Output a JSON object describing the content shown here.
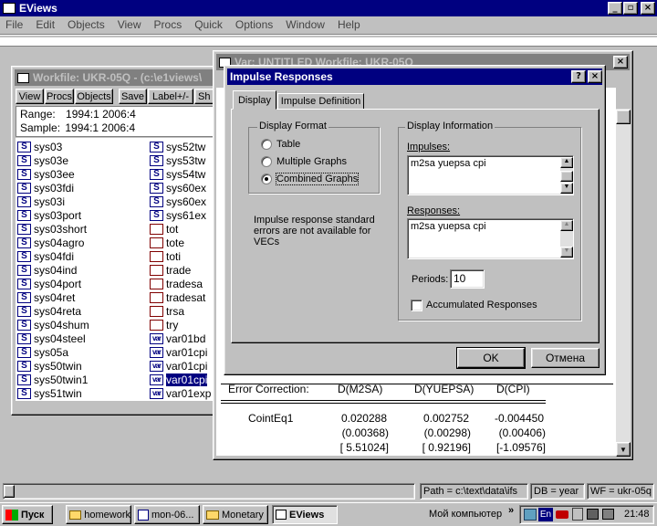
{
  "app": {
    "title": "EViews",
    "menu": [
      "File",
      "Edit",
      "Objects",
      "View",
      "Procs",
      "Quick",
      "Options",
      "Window",
      "Help"
    ]
  },
  "workfile": {
    "title": "Workfile: UKR-05Q - (c:\\e1views\\",
    "toolbar": [
      "View",
      "Procs",
      "Objects",
      "Save",
      "Label+/-",
      "Sh"
    ],
    "range_label": "Range:",
    "range_value": "1994:1 2006:4",
    "sample_label": "Sample:",
    "sample_value": "1994:1 2006:4",
    "col1": [
      {
        "t": "S",
        "n": "sys03"
      },
      {
        "t": "S",
        "n": "sys03e"
      },
      {
        "t": "S",
        "n": "sys03ee"
      },
      {
        "t": "S",
        "n": "sys03fdi"
      },
      {
        "t": "S",
        "n": "sys03i"
      },
      {
        "t": "S",
        "n": "sys03port"
      },
      {
        "t": "S",
        "n": "sys03short"
      },
      {
        "t": "S",
        "n": "sys04agro"
      },
      {
        "t": "S",
        "n": "sys04fdi"
      },
      {
        "t": "S",
        "n": "sys04ind"
      },
      {
        "t": "S",
        "n": "sys04port"
      },
      {
        "t": "S",
        "n": "sys04ret"
      },
      {
        "t": "S",
        "n": "sys04reta"
      },
      {
        "t": "S",
        "n": "sys04shum"
      },
      {
        "t": "S",
        "n": "sys04steel"
      },
      {
        "t": "S",
        "n": "sys05a"
      },
      {
        "t": "S",
        "n": "sys50twin"
      },
      {
        "t": "S",
        "n": "sys50twin1"
      },
      {
        "t": "S",
        "n": "sys51twin"
      }
    ],
    "col2": [
      {
        "t": "S",
        "n": "sys52tw"
      },
      {
        "t": "S",
        "n": "sys53tw"
      },
      {
        "t": "S",
        "n": "sys54tw"
      },
      {
        "t": "S",
        "n": "sys60ex"
      },
      {
        "t": "S",
        "n": "sys60ex"
      },
      {
        "t": "S",
        "n": "sys61ex"
      },
      {
        "t": "G",
        "n": "tot"
      },
      {
        "t": "G",
        "n": "tote"
      },
      {
        "t": "G",
        "n": "toti"
      },
      {
        "t": "G",
        "n": "trade"
      },
      {
        "t": "G",
        "n": "tradesa"
      },
      {
        "t": "G",
        "n": "tradesat"
      },
      {
        "t": "G",
        "n": "trsa"
      },
      {
        "t": "G",
        "n": "try"
      },
      {
        "t": "V",
        "n": "var01bd"
      },
      {
        "t": "V",
        "n": "var01cpi"
      },
      {
        "t": "V",
        "n": "var01cpi"
      },
      {
        "t": "V",
        "n": "var01cpi"
      },
      {
        "t": "V",
        "n": "var01exp"
      }
    ],
    "badge_labels": {
      "S": "S",
      "V": "var",
      "G": ""
    }
  },
  "var_window": {
    "title": "Var: UNTITLED   Workfile: UKR-05Q",
    "table": {
      "label": "Error Correction:",
      "headers": [
        "D(M2SA)",
        "D(YUEPSA)",
        "D(CPI)"
      ],
      "row_label": "CointEq1",
      "values": [
        "0.020288",
        "0.002752",
        "-0.004450"
      ],
      "se": [
        "(0.00368)",
        "(0.00298)",
        "(0.00406)"
      ],
      "t": [
        "[ 5.51024]",
        "[ 0.92196]",
        "[-1.09576]"
      ]
    }
  },
  "dialog": {
    "title": "Impulse Responses",
    "help": "?",
    "close": "×",
    "tabs": [
      "Display",
      "Impulse Definition"
    ],
    "display_format_label": "Display Format",
    "options": [
      "Table",
      "Multiple Graphs",
      "Combined Graphs"
    ],
    "selected": "Combined Graphs",
    "note": "Impulse response standard errors are not available for VECs",
    "display_info_label": "Display Information",
    "impulses_label": "Impulses:",
    "impulses_value": "m2sa yuepsa cpi",
    "responses_label": "Responses:",
    "responses_value": "m2sa yuepsa cpi",
    "periods_label": "Periods:",
    "periods_value": "10",
    "accumulated_label": "Accumulated Responses",
    "accumulated_checked": false,
    "ok": "OK",
    "cancel": "Отмена"
  },
  "status": {
    "path": "Path = c:\\text\\data\\ifs",
    "db": "DB = year",
    "wf": "WF = ukr-05q"
  },
  "taskbar": {
    "start": "Пуск",
    "buttons": [
      "homework",
      "mon-06...",
      "Monetary",
      "EViews"
    ],
    "active": "EViews",
    "mycomputer": "Мой компьютер",
    "lang": "En",
    "clock": "21:48"
  }
}
